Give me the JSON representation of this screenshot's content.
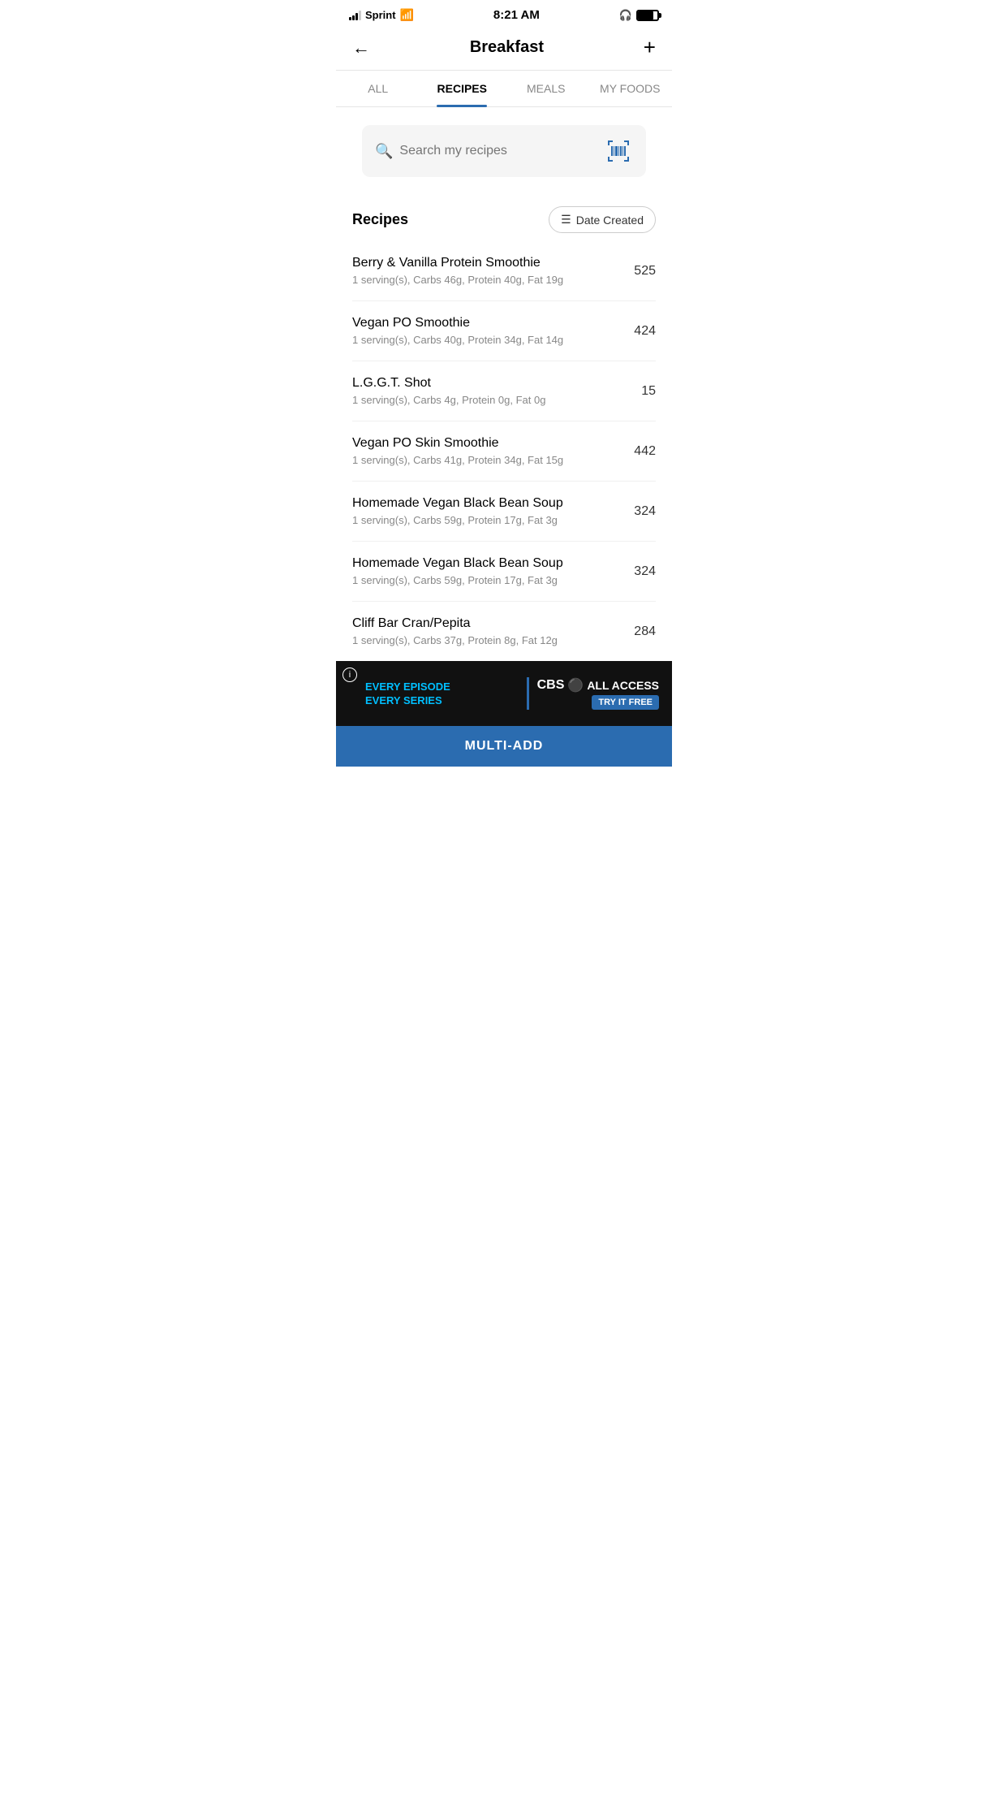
{
  "statusBar": {
    "carrier": "Sprint",
    "time": "8:21 AM"
  },
  "header": {
    "title": "Breakfast",
    "addLabel": "+"
  },
  "tabs": [
    {
      "id": "all",
      "label": "ALL",
      "active": false
    },
    {
      "id": "recipes",
      "label": "RECIPES",
      "active": true
    },
    {
      "id": "meals",
      "label": "MEALS",
      "active": false
    },
    {
      "id": "my-foods",
      "label": "MY FOODS",
      "active": false
    }
  ],
  "search": {
    "placeholder": "Search my recipes"
  },
  "recipesSection": {
    "title": "Recipes",
    "sortLabel": "Date Created"
  },
  "recipes": [
    {
      "name": "Berry & Vanilla Protein Smoothie",
      "details": "1 serving(s), Carbs 46g, Protein 40g, Fat 19g",
      "calories": "525"
    },
    {
      "name": "Vegan PO Smoothie",
      "details": "1 serving(s), Carbs 40g, Protein 34g, Fat 14g",
      "calories": "424"
    },
    {
      "name": "L.G.G.T. Shot",
      "details": "1 serving(s), Carbs 4g, Protein 0g, Fat 0g",
      "calories": "15"
    },
    {
      "name": "Vegan PO Skin Smoothie",
      "details": "1 serving(s), Carbs 41g, Protein 34g, Fat 15g",
      "calories": "442"
    },
    {
      "name": "Homemade Vegan Black Bean Soup",
      "details": "1 serving(s), Carbs 59g, Protein 17g, Fat 3g",
      "calories": "324"
    },
    {
      "name": "Homemade Vegan Black Bean Soup",
      "details": "1 serving(s), Carbs 59g, Protein 17g, Fat 3g",
      "calories": "324"
    },
    {
      "name": "Cliff Bar Cran/Pepita",
      "details": "1 serving(s), Carbs 37g, Protein 8g, Fat 12g",
      "calories": "284"
    }
  ],
  "ad": {
    "line1": "EVERY EPISODE",
    "line2": "EVERY SERIES",
    "cbsLogo": "CBS",
    "allAccess": "ALL ACCESS",
    "tryFree": "TRY IT FREE"
  },
  "multiAdd": {
    "label": "MULTI-ADD"
  }
}
